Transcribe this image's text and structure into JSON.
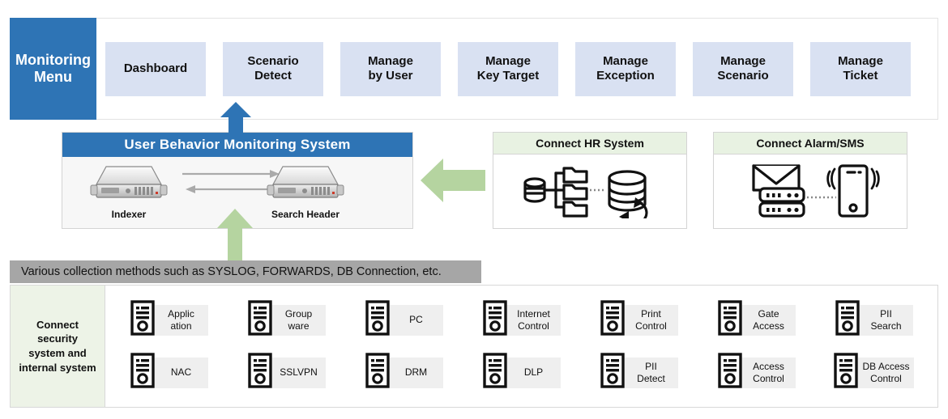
{
  "menu": {
    "title": "Monitoring\nMenu",
    "title_line1": "Monitoring",
    "title_line2": "Menu",
    "items": [
      {
        "label_line1": "Dashboard",
        "label_line2": ""
      },
      {
        "label_line1": "Scenario",
        "label_line2": "Detect"
      },
      {
        "label_line1": "Manage",
        "label_line2": "by User"
      },
      {
        "label_line1": "Manage",
        "label_line2": "Key Target"
      },
      {
        "label_line1": "Manage",
        "label_line2": "Exception"
      },
      {
        "label_line1": "Manage",
        "label_line2": "Scenario"
      },
      {
        "label_line1": "Manage",
        "label_line2": "Ticket"
      }
    ]
  },
  "ubms": {
    "header": "User Behavior Monitoring System",
    "nodes": [
      {
        "label": "Indexer",
        "icon": "rack-server-icon"
      },
      {
        "label": "Search Header",
        "icon": "rack-server-icon"
      }
    ],
    "exchange_icon": "bidirectional-arrows-icon"
  },
  "connectors": [
    {
      "title": "Connect HR System",
      "icon": "hr-database-sync-icon"
    },
    {
      "title": "Connect Alarm/SMS",
      "icon": "mail-server-phone-icon"
    }
  ],
  "collection": {
    "text": "Various collection methods such as SYSLOG, FORWARDS, DB Connection, etc."
  },
  "bottom": {
    "label_lines": [
      "Connect",
      "security",
      "system and",
      "internal system"
    ],
    "systems_row1": [
      {
        "line1": "Applic",
        "line2": "ation"
      },
      {
        "line1": "Group",
        "line2": "ware"
      },
      {
        "line1": "PC",
        "line2": ""
      },
      {
        "line1": "Internet",
        "line2": "Control"
      },
      {
        "line1": "Print",
        "line2": "Control"
      },
      {
        "line1": "Gate",
        "line2": "Access"
      },
      {
        "line1": "PII",
        "line2": "Search"
      }
    ],
    "systems_row2": [
      {
        "line1": "NAC",
        "line2": ""
      },
      {
        "line1": "SSLVPN",
        "line2": ""
      },
      {
        "line1": "DRM",
        "line2": ""
      },
      {
        "line1": "DLP",
        "line2": ""
      },
      {
        "line1": "PII",
        "line2": "Detect"
      },
      {
        "line1": "Access",
        "line2": "Control"
      },
      {
        "line1": "DB Access",
        "line2": "Control"
      }
    ]
  },
  "arrows": {
    "menu_up": "blue-up-arrow-icon",
    "connectors_left": "green-left-arrow-icon",
    "collection_up": "green-up-arrow-icon"
  },
  "colors": {
    "brand_blue": "#2E74B5",
    "menu_item_blue": "#D9E1F2",
    "green_arrow": "#B5D4A0",
    "green_header": "#E8F2E2",
    "green_panel": "#EDF3E7",
    "gray_bar": "#A6A6A6",
    "chip_gray": "#EFEFEF"
  }
}
